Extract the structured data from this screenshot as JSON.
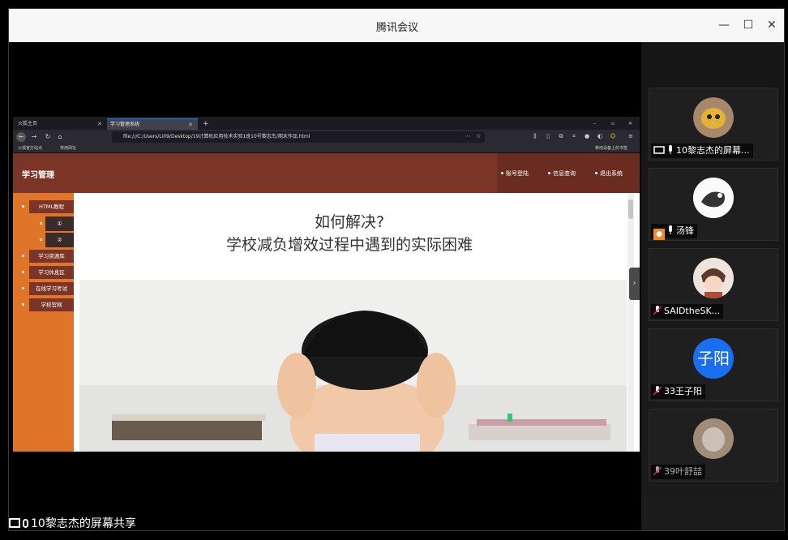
{
  "window": {
    "title": "腾讯会议",
    "minimize_glyph": "—",
    "maximize_glyph": "☐",
    "close_glyph": "✕"
  },
  "share_label": "10黎志杰的屏幕共享",
  "browser": {
    "tabs": [
      {
        "label": "火狐主页",
        "active": false
      },
      {
        "label": "学习管理系统",
        "active": true
      }
    ],
    "new_tab_glyph": "+",
    "url": "file:///C:/Users/Li09/Desktop/19计算机应用技术实验1班10号黎志杰/期末作品.html",
    "bookmarks": [
      "火狐官方站点",
      "常用网址"
    ],
    "bookmarks_right": "移动设备上的书签"
  },
  "site": {
    "title": "学习管理",
    "nav": [
      "账号登陆",
      "信息查询",
      "退出系统"
    ],
    "sidebar": [
      "HTML教程",
      "学习资源库",
      "学习休息区",
      "在线学习考试",
      "学校官网"
    ],
    "sidebar_sub": [
      "①",
      "②"
    ],
    "headline_1": "如何解决?",
    "headline_2": "学校减负增效过程中遇到的实际困难"
  },
  "participants": [
    {
      "name": "10黎志杰的屏幕...",
      "sharing": true,
      "muted": false,
      "avatar_color": "#8a6d3b"
    },
    {
      "name": "汤锋",
      "host": true,
      "muted": false,
      "avatar_color": "#ffffff"
    },
    {
      "name": "SAIDtheSK...",
      "muted": true,
      "avatar_color": "#b07a6a"
    },
    {
      "name": "33王子阳",
      "muted": true,
      "avatar_text": "子阳",
      "avatar_color": "#1a6ff0"
    },
    {
      "name": "39叶舒喆",
      "muted": true,
      "dim": true,
      "avatar_color": "#8a7060"
    }
  ]
}
